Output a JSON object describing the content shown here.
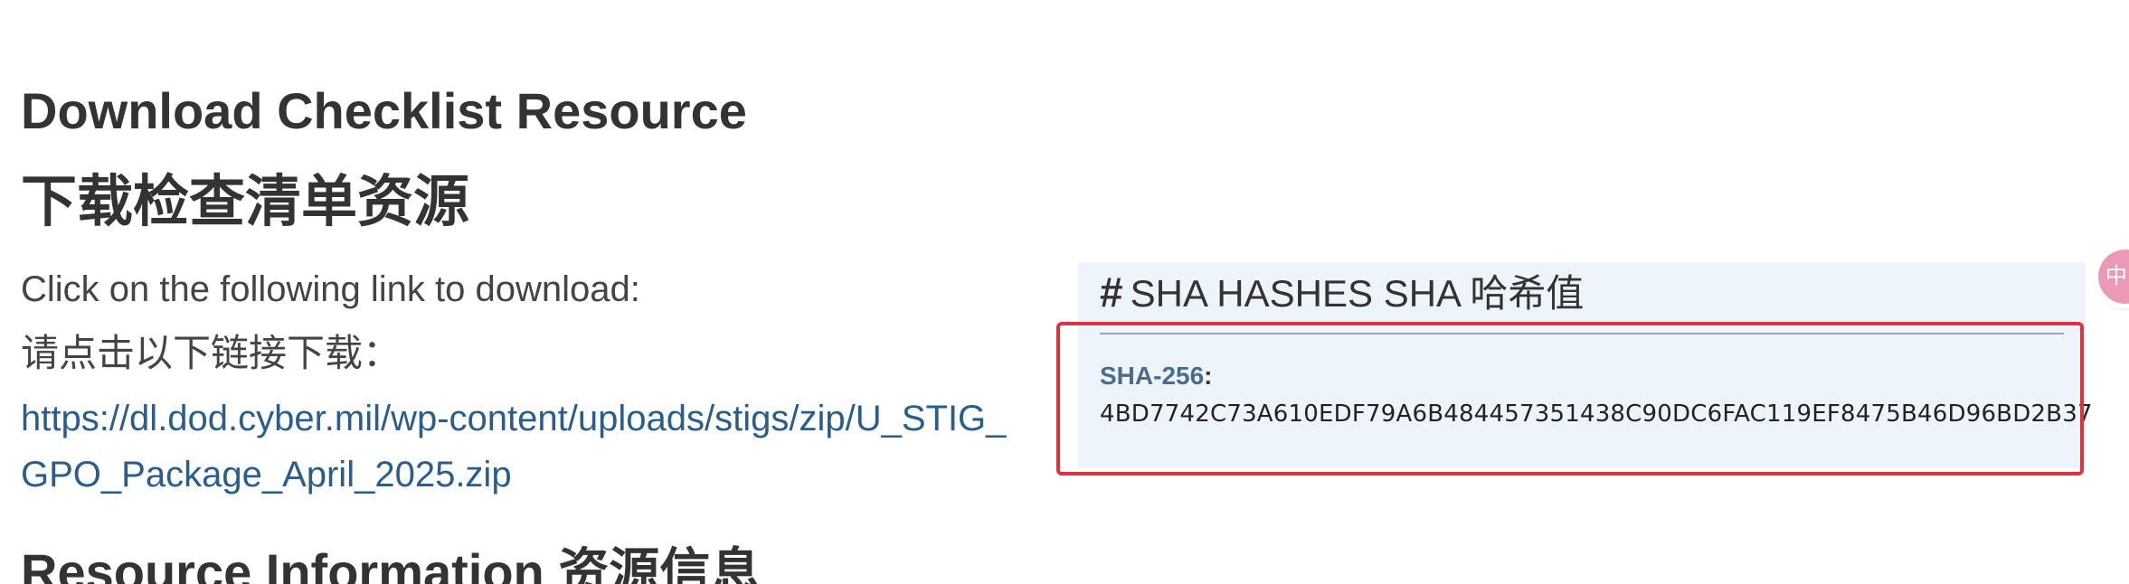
{
  "page": {
    "heading_en": "Download Checklist Resource",
    "heading_zh": "下载检查清单资源",
    "instruction_en": "Click on the following link to download:",
    "instruction_zh": "请点击以下链接下载：",
    "download_link": "https://dl.dod.cyber.mil/wp-content/uploads/stigs/zip/U_STIG_GPO_Package_April_2025.zip",
    "next_heading": "Resource Information 资源信息"
  },
  "sha_box": {
    "icon": "#",
    "title": "SHA HASHES  SHA 哈希值",
    "hash_type": "SHA-256",
    "colon": ":",
    "hash_value": "4BD7742C73A610EDF79A6B484457351438C90DC6FAC119EF8475B46D96BD2B37"
  },
  "side_widget": {
    "icon": "translate-widget-icon",
    "label": "中",
    "color": "#ea9ab5"
  },
  "colors": {
    "link": "#2a5d8c",
    "hash_label": "#4a6c8c",
    "sha_box_bg": "#eef4fb",
    "highlight": "#e0323a"
  }
}
